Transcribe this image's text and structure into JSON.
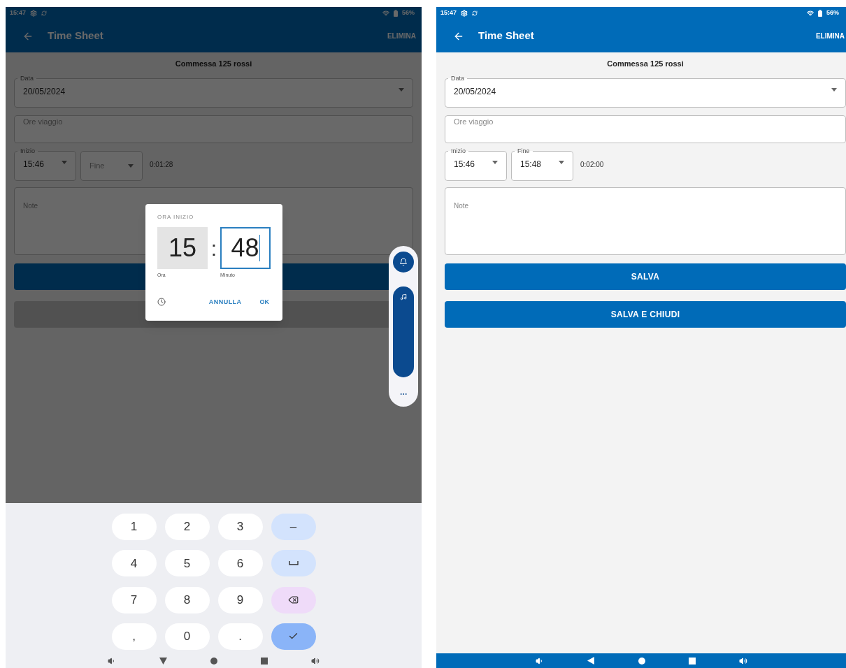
{
  "screens": [
    {
      "dimmed": true,
      "status_bar": {
        "time": "15:47",
        "battery": "56%"
      },
      "app_bar": {
        "title": "Time Sheet",
        "action": "ELIMINA"
      },
      "subtitle": "Commessa 125 rossi",
      "date_field": {
        "label": "Data",
        "value": "20/05/2024"
      },
      "travel_field": {
        "placeholder": "Ore viaggio"
      },
      "start_field": {
        "label": "Inizio",
        "value": "15:46"
      },
      "end_field": {
        "placeholder": "Fine"
      },
      "duration": "0:01:28",
      "notes_field": {
        "placeholder": "Note"
      },
      "buttons": [
        {
          "disabled": false
        },
        {
          "disabled": true
        }
      ],
      "time_dialog": {
        "title": "ORA INIZIO",
        "separator": ":",
        "hour": {
          "value": "15",
          "label": "Ora",
          "selected": false
        },
        "minute": {
          "value": "48",
          "label": "Minuto",
          "selected": true
        },
        "cancel": "ANNULLA",
        "ok": "OK"
      },
      "volume_panel": {
        "level": 1
      },
      "keyboard": {
        "keys": [
          {
            "kind": "text",
            "label": "1"
          },
          {
            "kind": "text",
            "label": "2"
          },
          {
            "kind": "text",
            "label": "3"
          },
          {
            "kind": "action",
            "label": "–"
          },
          {
            "kind": "text",
            "label": "4"
          },
          {
            "kind": "text",
            "label": "5"
          },
          {
            "kind": "text",
            "label": "6"
          },
          {
            "kind": "space"
          },
          {
            "kind": "text",
            "label": "7"
          },
          {
            "kind": "text",
            "label": "8"
          },
          {
            "kind": "text",
            "label": "9"
          },
          {
            "kind": "backspace"
          },
          {
            "kind": "text",
            "label": ","
          },
          {
            "kind": "text",
            "label": "0"
          },
          {
            "kind": "text",
            "label": "."
          },
          {
            "kind": "done"
          }
        ]
      }
    },
    {
      "dimmed": false,
      "status_bar": {
        "time": "15:47",
        "battery": "56%"
      },
      "app_bar": {
        "title": "Time Sheet",
        "action": "ELIMINA"
      },
      "subtitle": "Commessa 125 rossi",
      "date_field": {
        "label": "Data",
        "value": "20/05/2024"
      },
      "travel_field": {
        "placeholder": "Ore viaggio"
      },
      "start_field": {
        "label": "Inizio",
        "value": "15:46"
      },
      "end_field": {
        "label": "Fine",
        "value": "15:48"
      },
      "duration": "0:02:00",
      "notes_field": {
        "placeholder": "Note"
      },
      "buttons": [
        {
          "disabled": false,
          "label": "SALVA"
        },
        {
          "disabled": false,
          "label": "SALVA E CHIUDI"
        }
      ]
    }
  ]
}
